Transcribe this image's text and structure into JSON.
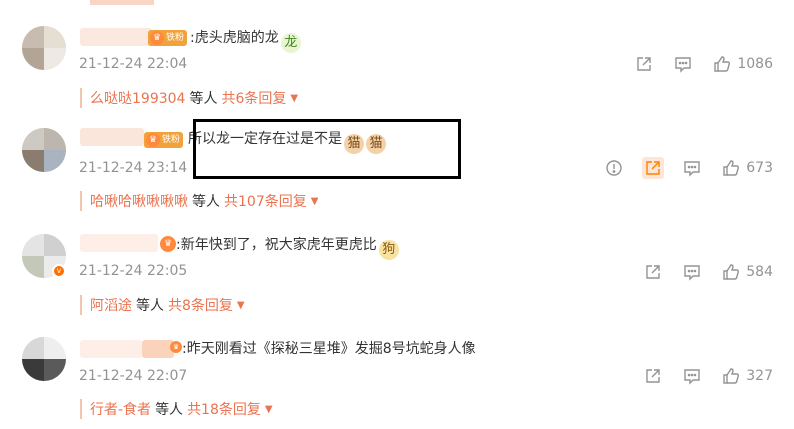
{
  "fan_badge_label": "铁粉",
  "comments": [
    {
      "text": ":虎头虎脑的龙",
      "emoji": [
        "dragon-emoji"
      ],
      "time": "21-12-24 22:04",
      "likes": "1086",
      "reply_user": "么哒哒199304",
      "reply_mid": "等人",
      "reply_count": "共6条回复"
    },
    {
      "text": "所以龙一定存在过是不是",
      "emoji": [
        "cat-emoji",
        "cat-emoji"
      ],
      "time": "21-12-24 23:14",
      "likes": "673",
      "reply_user": "哈啾哈啾啾啾啾",
      "reply_mid": "等人",
      "reply_count": "共107条回复"
    },
    {
      "text": ":新年快到了，祝大家虎年更虎比",
      "emoji": [
        "dog-emoji"
      ],
      "time": "21-12-24 22:05",
      "likes": "584",
      "reply_user": "阿滔途",
      "reply_mid": "等人",
      "reply_count": "共8条回复"
    },
    {
      "text": ":昨天刚看过《探秘三星堆》发掘8号坑蛇身人像",
      "emoji": [],
      "time": "21-12-24 22:07",
      "likes": "327",
      "reply_user": "行者-食者",
      "reply_mid": "等人",
      "reply_count": "共18条回复"
    }
  ],
  "colors": {
    "accent": "#eb7350",
    "highlight": "#ff8200",
    "meta": "#939393",
    "badge": "#f2a23a"
  }
}
